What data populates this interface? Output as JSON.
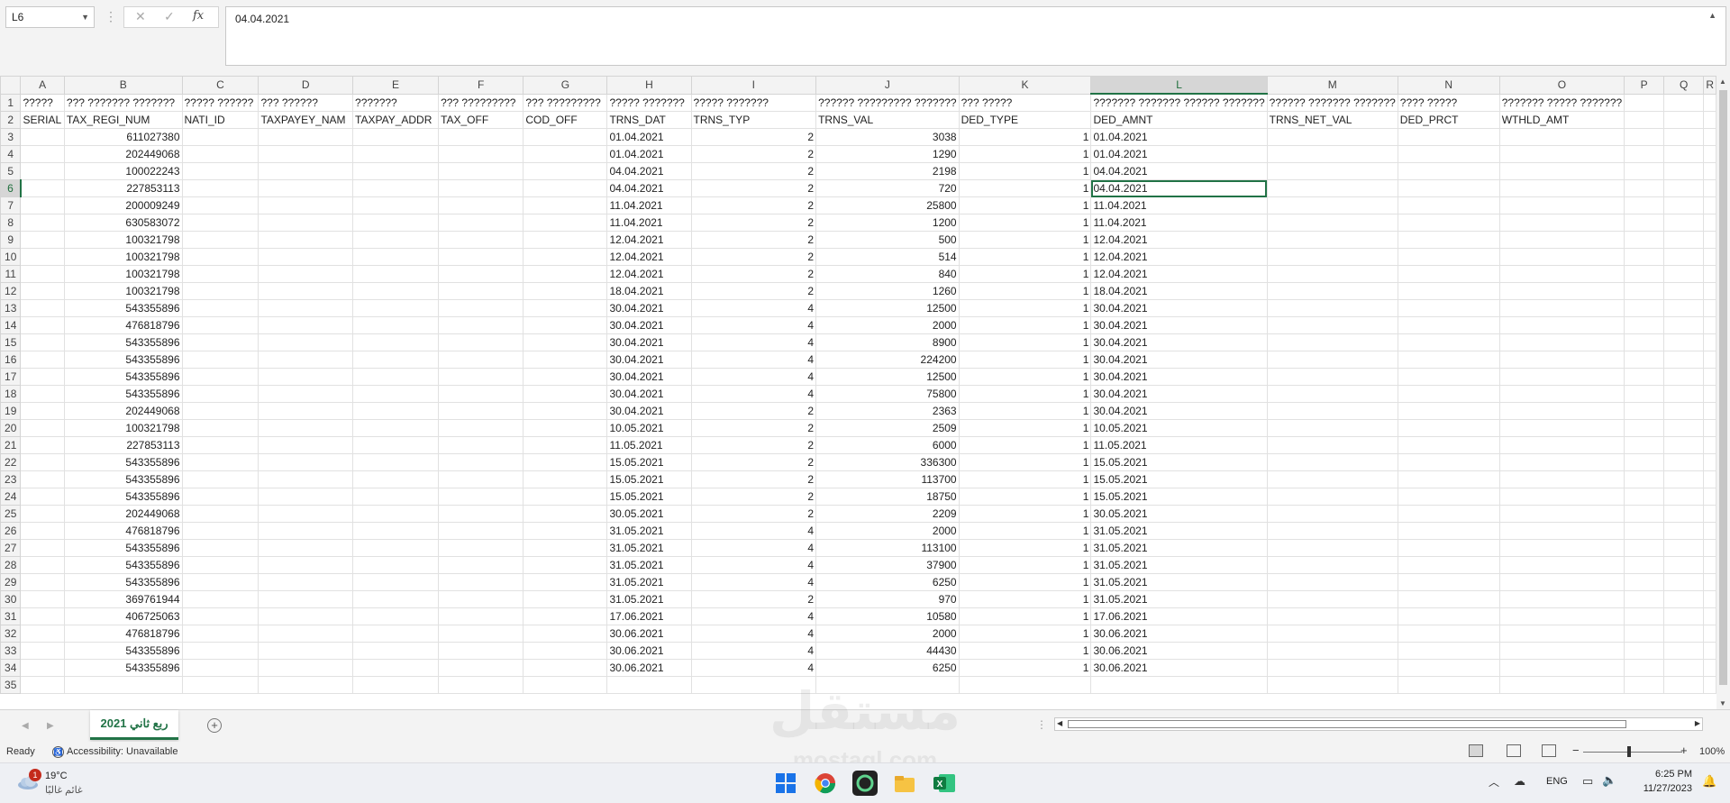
{
  "formula_bar": {
    "name_box": "L6",
    "fx_symbol": "fx",
    "cancel_symbol": "✕",
    "enter_symbol": "✓",
    "value": "04.04.2021"
  },
  "columns": [
    "A",
    "B",
    "C",
    "D",
    "E",
    "F",
    "G",
    "H",
    "I",
    "J",
    "K",
    "L",
    "M",
    "N",
    "O",
    "P",
    "Q",
    "R"
  ],
  "selected_column": "L",
  "selected_row": 6,
  "rows": [
    {
      "n": 1,
      "cells": [
        "?????",
        "??? ??????? ???????",
        "????? ??????",
        "??? ??????",
        "???????",
        "??? ?????????",
        "??? ?????????",
        "????? ???????",
        "????? ???????",
        "?????? ????????? ???????",
        "??? ?????",
        "??????? ??????? ?????? ???????",
        "?????? ??????? ???????",
        "???? ?????",
        "??????? ????? ???????",
        "",
        "",
        ""
      ]
    },
    {
      "n": 2,
      "cells": [
        "SERIAL",
        "TAX_REGI_NUM",
        "NATI_ID",
        "TAXPAYEY_NAM",
        "TAXPAY_ADDR",
        "TAX_OFF",
        "COD_OFF",
        "TRNS_DAT",
        "TRNS_TYP",
        "TRNS_VAL",
        "DED_TYPE",
        "DED_AMNT",
        "TRNS_NET_VAL",
        "DED_PRCT",
        "WTHLD_AMT",
        "",
        "",
        ""
      ]
    },
    {
      "n": 3,
      "cells": [
        "",
        "611027380",
        "",
        "",
        "",
        "",
        "",
        "01.04.2021",
        "2",
        "3038",
        "1",
        "01.04.2021",
        "",
        "",
        "",
        "",
        "",
        ""
      ]
    },
    {
      "n": 4,
      "cells": [
        "",
        "202449068",
        "",
        "",
        "",
        "",
        "",
        "01.04.2021",
        "2",
        "1290",
        "1",
        "01.04.2021",
        "",
        "",
        "",
        "",
        "",
        ""
      ]
    },
    {
      "n": 5,
      "cells": [
        "",
        "100022243",
        "",
        "",
        "",
        "",
        "",
        "04.04.2021",
        "2",
        "2198",
        "1",
        "04.04.2021",
        "",
        "",
        "",
        "",
        "",
        ""
      ]
    },
    {
      "n": 6,
      "cells": [
        "",
        "227853113",
        "",
        "",
        "",
        "",
        "",
        "04.04.2021",
        "2",
        "720",
        "1",
        "04.04.2021",
        "",
        "",
        "",
        "",
        "",
        ""
      ]
    },
    {
      "n": 7,
      "cells": [
        "",
        "200009249",
        "",
        "",
        "",
        "",
        "",
        "11.04.2021",
        "2",
        "25800",
        "1",
        "11.04.2021",
        "",
        "",
        "",
        "",
        "",
        ""
      ]
    },
    {
      "n": 8,
      "cells": [
        "",
        "630583072",
        "",
        "",
        "",
        "",
        "",
        "11.04.2021",
        "2",
        "1200",
        "1",
        "11.04.2021",
        "",
        "",
        "",
        "",
        "",
        ""
      ]
    },
    {
      "n": 9,
      "cells": [
        "",
        "100321798",
        "",
        "",
        "",
        "",
        "",
        "12.04.2021",
        "2",
        "500",
        "1",
        "12.04.2021",
        "",
        "",
        "",
        "",
        "",
        ""
      ]
    },
    {
      "n": 10,
      "cells": [
        "",
        "100321798",
        "",
        "",
        "",
        "",
        "",
        "12.04.2021",
        "2",
        "514",
        "1",
        "12.04.2021",
        "",
        "",
        "",
        "",
        "",
        ""
      ]
    },
    {
      "n": 11,
      "cells": [
        "",
        "100321798",
        "",
        "",
        "",
        "",
        "",
        "12.04.2021",
        "2",
        "840",
        "1",
        "12.04.2021",
        "",
        "",
        "",
        "",
        "",
        ""
      ]
    },
    {
      "n": 12,
      "cells": [
        "",
        "100321798",
        "",
        "",
        "",
        "",
        "",
        "18.04.2021",
        "2",
        "1260",
        "1",
        "18.04.2021",
        "",
        "",
        "",
        "",
        "",
        ""
      ]
    },
    {
      "n": 13,
      "cells": [
        "",
        "543355896",
        "",
        "",
        "",
        "",
        "",
        "30.04.2021",
        "4",
        "12500",
        "1",
        "30.04.2021",
        "",
        "",
        "",
        "",
        "",
        ""
      ]
    },
    {
      "n": 14,
      "cells": [
        "",
        "476818796",
        "",
        "",
        "",
        "",
        "",
        "30.04.2021",
        "4",
        "2000",
        "1",
        "30.04.2021",
        "",
        "",
        "",
        "",
        "",
        ""
      ]
    },
    {
      "n": 15,
      "cells": [
        "",
        "543355896",
        "",
        "",
        "",
        "",
        "",
        "30.04.2021",
        "4",
        "8900",
        "1",
        "30.04.2021",
        "",
        "",
        "",
        "",
        "",
        ""
      ]
    },
    {
      "n": 16,
      "cells": [
        "",
        "543355896",
        "",
        "",
        "",
        "",
        "",
        "30.04.2021",
        "4",
        "224200",
        "1",
        "30.04.2021",
        "",
        "",
        "",
        "",
        "",
        ""
      ]
    },
    {
      "n": 17,
      "cells": [
        "",
        "543355896",
        "",
        "",
        "",
        "",
        "",
        "30.04.2021",
        "4",
        "12500",
        "1",
        "30.04.2021",
        "",
        "",
        "",
        "",
        "",
        ""
      ]
    },
    {
      "n": 18,
      "cells": [
        "",
        "543355896",
        "",
        "",
        "",
        "",
        "",
        "30.04.2021",
        "4",
        "75800",
        "1",
        "30.04.2021",
        "",
        "",
        "",
        "",
        "",
        ""
      ]
    },
    {
      "n": 19,
      "cells": [
        "",
        "202449068",
        "",
        "",
        "",
        "",
        "",
        "30.04.2021",
        "2",
        "2363",
        "1",
        "30.04.2021",
        "",
        "",
        "",
        "",
        "",
        ""
      ]
    },
    {
      "n": 20,
      "cells": [
        "",
        "100321798",
        "",
        "",
        "",
        "",
        "",
        "10.05.2021",
        "2",
        "2509",
        "1",
        "10.05.2021",
        "",
        "",
        "",
        "",
        "",
        ""
      ]
    },
    {
      "n": 21,
      "cells": [
        "",
        "227853113",
        "",
        "",
        "",
        "",
        "",
        "11.05.2021",
        "2",
        "6000",
        "1",
        "11.05.2021",
        "",
        "",
        "",
        "",
        "",
        ""
      ]
    },
    {
      "n": 22,
      "cells": [
        "",
        "543355896",
        "",
        "",
        "",
        "",
        "",
        "15.05.2021",
        "2",
        "336300",
        "1",
        "15.05.2021",
        "",
        "",
        "",
        "",
        "",
        ""
      ]
    },
    {
      "n": 23,
      "cells": [
        "",
        "543355896",
        "",
        "",
        "",
        "",
        "",
        "15.05.2021",
        "2",
        "113700",
        "1",
        "15.05.2021",
        "",
        "",
        "",
        "",
        "",
        ""
      ]
    },
    {
      "n": 24,
      "cells": [
        "",
        "543355896",
        "",
        "",
        "",
        "",
        "",
        "15.05.2021",
        "2",
        "18750",
        "1",
        "15.05.2021",
        "",
        "",
        "",
        "",
        "",
        ""
      ]
    },
    {
      "n": 25,
      "cells": [
        "",
        "202449068",
        "",
        "",
        "",
        "",
        "",
        "30.05.2021",
        "2",
        "2209",
        "1",
        "30.05.2021",
        "",
        "",
        "",
        "",
        "",
        ""
      ]
    },
    {
      "n": 26,
      "cells": [
        "",
        "476818796",
        "",
        "",
        "",
        "",
        "",
        "31.05.2021",
        "4",
        "2000",
        "1",
        "31.05.2021",
        "",
        "",
        "",
        "",
        "",
        ""
      ]
    },
    {
      "n": 27,
      "cells": [
        "",
        "543355896",
        "",
        "",
        "",
        "",
        "",
        "31.05.2021",
        "4",
        "113100",
        "1",
        "31.05.2021",
        "",
        "",
        "",
        "",
        "",
        ""
      ]
    },
    {
      "n": 28,
      "cells": [
        "",
        "543355896",
        "",
        "",
        "",
        "",
        "",
        "31.05.2021",
        "4",
        "37900",
        "1",
        "31.05.2021",
        "",
        "",
        "",
        "",
        "",
        ""
      ]
    },
    {
      "n": 29,
      "cells": [
        "",
        "543355896",
        "",
        "",
        "",
        "",
        "",
        "31.05.2021",
        "4",
        "6250",
        "1",
        "31.05.2021",
        "",
        "",
        "",
        "",
        "",
        ""
      ]
    },
    {
      "n": 30,
      "cells": [
        "",
        "369761944",
        "",
        "",
        "",
        "",
        "",
        "31.05.2021",
        "2",
        "970",
        "1",
        "31.05.2021",
        "",
        "",
        "",
        "",
        "",
        ""
      ]
    },
    {
      "n": 31,
      "cells": [
        "",
        "406725063",
        "",
        "",
        "",
        "",
        "",
        "17.06.2021",
        "4",
        "10580",
        "1",
        "17.06.2021",
        "",
        "",
        "",
        "",
        "",
        ""
      ]
    },
    {
      "n": 32,
      "cells": [
        "",
        "476818796",
        "",
        "",
        "",
        "",
        "",
        "30.06.2021",
        "4",
        "2000",
        "1",
        "30.06.2021",
        "",
        "",
        "",
        "",
        "",
        ""
      ]
    },
    {
      "n": 33,
      "cells": [
        "",
        "543355896",
        "",
        "",
        "",
        "",
        "",
        "30.06.2021",
        "4",
        "44430",
        "1",
        "30.06.2021",
        "",
        "",
        "",
        "",
        "",
        ""
      ]
    },
    {
      "n": 34,
      "cells": [
        "",
        "543355896",
        "",
        "",
        "",
        "",
        "",
        "30.06.2021",
        "4",
        "6250",
        "1",
        "30.06.2021",
        "",
        "",
        "",
        "",
        "",
        ""
      ]
    },
    {
      "n": 35,
      "cells": [
        "",
        "",
        "",
        "",
        "",
        "",
        "",
        "",
        "",
        "",
        "",
        "",
        "",
        "",
        "",
        "",
        "",
        ""
      ]
    }
  ],
  "sheet_tabs": [
    "ربع ثاني 2021"
  ],
  "status": {
    "ready": "Ready",
    "accessibility": "Accessibility: Unavailable",
    "zoom": "100%"
  },
  "taskbar": {
    "weather_temp": "19°C",
    "weather_desc": "غائم غالبًا",
    "weather_badge": "1",
    "language": "ENG",
    "time": "6:25 PM",
    "date": "11/27/2023"
  },
  "watermark": {
    "main": "مستقل",
    "sub": "mostaql.com"
  },
  "colors": {
    "accent": "#217346",
    "header_bg": "#f3f3f3"
  }
}
